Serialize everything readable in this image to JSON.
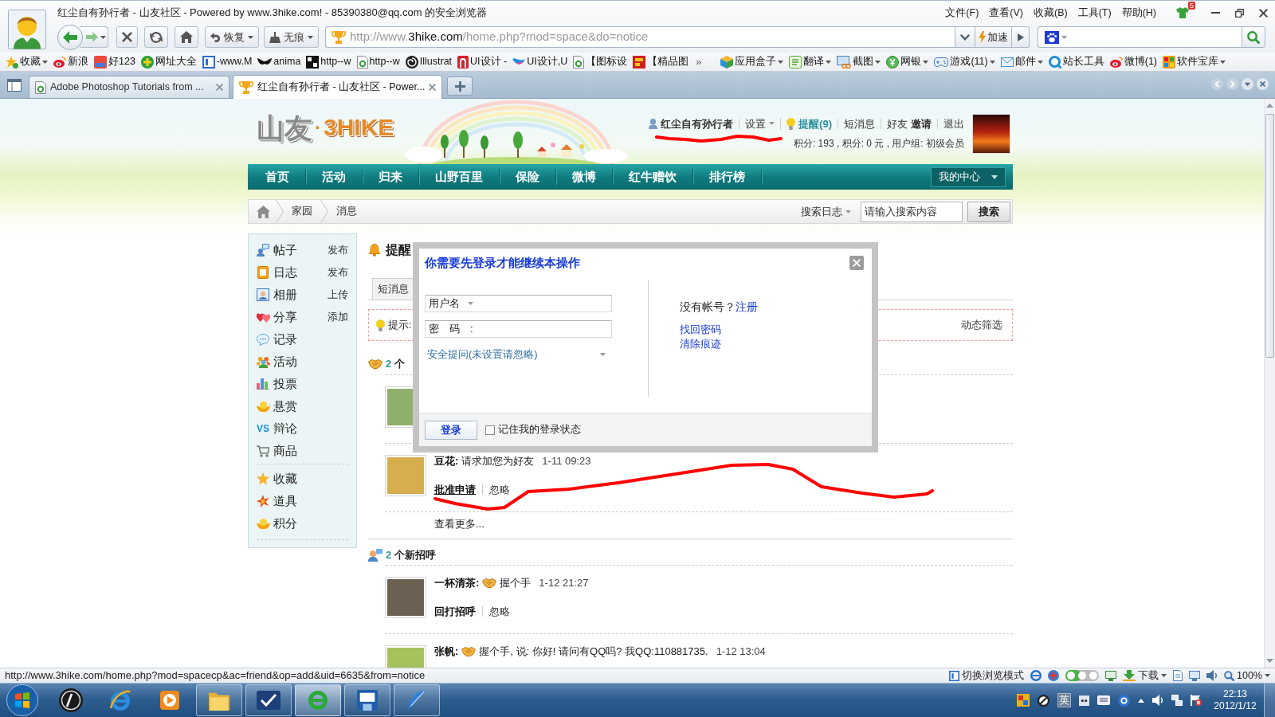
{
  "window": {
    "title": "红尘自有孙行者 - 山友社区 - Powered by www.3hike.com! - 85390380@qq.com 的安全浏览器",
    "menu": [
      "文件(F)",
      "查看(V)",
      "收藏(B)",
      "工具(T)",
      "帮助(H)"
    ],
    "notification_count": "5"
  },
  "toolbar": {
    "history_buttons": [
      {
        "kind": "restore",
        "label": "恢复"
      },
      {
        "kind": "incognito",
        "label": "无痕"
      }
    ],
    "address": {
      "prefix": "http://www.",
      "host": "3hike.com",
      "path": "/home.php?mod=space&do=notice"
    },
    "speed_up": "加速"
  },
  "favorites": {
    "links": [
      {
        "label": "收藏",
        "dropdown": true
      },
      {
        "label": "新浪",
        "dropdown": false
      },
      {
        "label": "好123",
        "dropdown": false
      },
      {
        "label": "网址大全",
        "dropdown": false
      },
      {
        "label": "-www.M",
        "dropdown": false
      },
      {
        "label": "anima",
        "dropdown": false
      },
      {
        "label": "http--w",
        "dropdown": false
      },
      {
        "label": "http--w",
        "dropdown": false
      },
      {
        "label": "Illustrat",
        "dropdown": false
      },
      {
        "label": "UI设计 -",
        "dropdown": false
      },
      {
        "label": "UI设计,U",
        "dropdown": false
      },
      {
        "label": "【图标设",
        "dropdown": false
      },
      {
        "label": "【精品图",
        "dropdown": false
      }
    ],
    "more": "»",
    "apps": [
      {
        "label": "应用盒子",
        "dropdown": true
      },
      {
        "label": "翻译",
        "dropdown": true
      },
      {
        "label": "截图",
        "dropdown": true
      },
      {
        "label": "网银",
        "dropdown": true
      },
      {
        "label": "游戏(11)",
        "dropdown": true
      },
      {
        "label": "邮件",
        "dropdown": true
      },
      {
        "label": "站长工具",
        "dropdown": false
      },
      {
        "label": "微博(1)",
        "dropdown": false
      },
      {
        "label": "软件宝库",
        "dropdown": true
      }
    ]
  },
  "tabs": [
    {
      "title": "Adobe Photoshop Tutorials from ...",
      "selected": false
    },
    {
      "title": "红尘自有孙行者 - 山友社区 - Power...",
      "selected": true
    }
  ],
  "site": {
    "logo": {
      "name": "山友",
      "dot": "·",
      "brand": "3HIKE"
    },
    "user_bar": {
      "username": "红尘自有孙行者",
      "settings": "设置",
      "reminders": "提醒(9)",
      "messages": "短消息",
      "friends": "好友",
      "invite": "邀请",
      "logout": "退出"
    },
    "stats": "积分: 193 , 积分: 0 元 , 用户组: 初级会员",
    "nav": [
      "首页",
      "活动",
      "归来",
      "山野百里",
      "保险",
      "微博",
      "红牛赠饮",
      "排行榜"
    ],
    "my_center": "我的中心",
    "breadcrumb": [
      "家园",
      "消息"
    ],
    "search": {
      "scope": "搜索日志",
      "placeholder": "请输入搜索内容",
      "button": "搜索"
    },
    "sidebar": {
      "apps": [
        {
          "label": "帖子",
          "action": "发布"
        },
        {
          "label": "日志",
          "action": "发布"
        },
        {
          "label": "相册",
          "action": "上传"
        },
        {
          "label": "分享",
          "action": "添加"
        },
        {
          "label": "记录"
        },
        {
          "label": "活动"
        },
        {
          "label": "投票"
        },
        {
          "label": "悬赏"
        },
        {
          "label": "辩论",
          "icon_text": "VS"
        },
        {
          "label": "商品"
        }
      ],
      "tools": [
        {
          "label": "收藏"
        },
        {
          "label": "道具"
        },
        {
          "label": "积分"
        }
      ]
    },
    "notices": {
      "title": "提醒",
      "tabs": [
        {
          "label": "短消息",
          "selected": false
        }
      ],
      "tip": "提示:",
      "filter": "动态筛选",
      "sections": [
        {
          "kind": "friend_requests",
          "count": "2",
          "label": "个",
          "items": [
            {
              "kind": "covered"
            },
            {
              "kind": "entry",
              "name": "豆花:",
              "poke": false,
              "message": "请求加您为好友",
              "time": "1-11 09:23",
              "actions": [
                {
                  "label": "批准申请",
                  "hovered": true
                },
                {
                  "label": "忽略",
                  "hovered": false
                }
              ]
            }
          ],
          "more": "查看更多..."
        },
        {
          "kind": "greetings",
          "count": "2",
          "label": "个新招呼",
          "items": [
            {
              "kind": "entry",
              "name": "一杯清茶:",
              "poke": true,
              "message": "握个手",
              "time": "1-12 21:27",
              "actions": [
                {
                  "label": "回打招呼",
                  "hovered": false
                },
                {
                  "label": "忽略",
                  "hovered": false
                }
              ]
            },
            {
              "kind": "entry",
              "name": "张帆:",
              "poke": true,
              "message": "握个手, 说: 你好! 请问有QQ吗? 我QQ:110881735.",
              "time": "1-12 13:04"
            }
          ]
        }
      ]
    }
  },
  "dialog": {
    "title": "你需要先登录才能继续本操作",
    "username_label": "用户名",
    "password_label": "密　码　:",
    "question": "安全提问(未设置请忽略)",
    "no_account": "没有帐号？",
    "register": "注册",
    "links": [
      "找回密码",
      "清除痕迹"
    ],
    "login": "登录",
    "remember": {
      "label": "记住我的登录状态",
      "checked": false
    }
  },
  "status_bar": {
    "url": "http://www.3hike.com/home.php?mod=spacecp&ac=friend&op=add&uid=6635&from=notice",
    "mode": "切换浏览模式",
    "download": "下载",
    "zoom": "100%"
  },
  "taskbar": {
    "apps": [
      {
        "running": false,
        "selected": false
      },
      {
        "running": false,
        "selected": false
      },
      {
        "running": false,
        "selected": false
      },
      {
        "running": true,
        "selected": false
      },
      {
        "running": true,
        "selected": false
      },
      {
        "running": true,
        "selected": true
      },
      {
        "running": true,
        "selected": false
      },
      {
        "running": true,
        "selected": false
      }
    ],
    "ime": "英",
    "time": "22:13",
    "date": "2012/1/12"
  }
}
